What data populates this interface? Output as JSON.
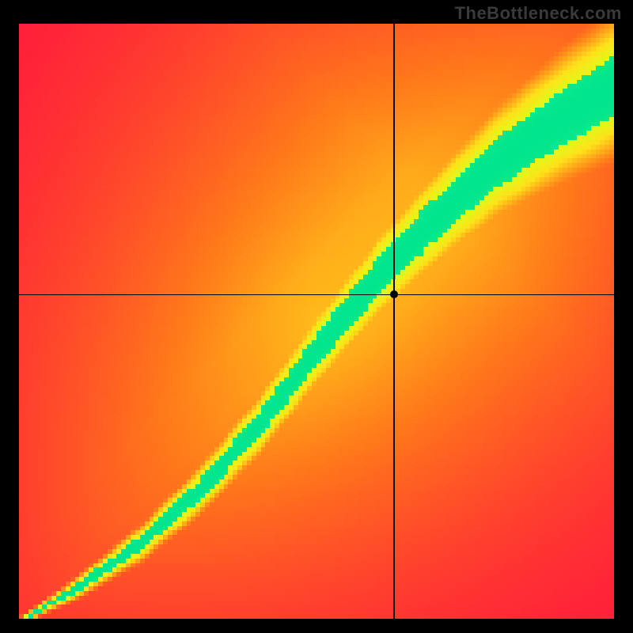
{
  "watermark": "TheBottleneck.com",
  "chart_data": {
    "type": "heatmap",
    "title": "",
    "xlabel": "",
    "ylabel": "",
    "xlim": [
      0,
      1
    ],
    "ylim": [
      0,
      1
    ],
    "resolution": 128,
    "colormap": {
      "stops": [
        {
          "t": 0.0,
          "color": "#ff1a3c"
        },
        {
          "t": 0.25,
          "color": "#ff7a1a"
        },
        {
          "t": 0.5,
          "color": "#ffe21a"
        },
        {
          "t": 0.75,
          "color": "#d8ff1a"
        },
        {
          "t": 0.9,
          "color": "#4dff6a"
        },
        {
          "t": 1.0,
          "color": "#00e58f"
        }
      ]
    },
    "ridge": [
      {
        "x": 0.0,
        "y": 0.0
      },
      {
        "x": 0.1,
        "y": 0.06
      },
      {
        "x": 0.2,
        "y": 0.13
      },
      {
        "x": 0.3,
        "y": 0.22
      },
      {
        "x": 0.4,
        "y": 0.33
      },
      {
        "x": 0.5,
        "y": 0.46
      },
      {
        "x": 0.6,
        "y": 0.58
      },
      {
        "x": 0.7,
        "y": 0.68
      },
      {
        "x": 0.8,
        "y": 0.77
      },
      {
        "x": 0.9,
        "y": 0.84
      },
      {
        "x": 1.0,
        "y": 0.9
      }
    ],
    "band_scale": 0.16,
    "crosshair": {
      "x": 0.63,
      "y": 0.545
    },
    "marker": {
      "x": 0.63,
      "y": 0.545
    }
  }
}
